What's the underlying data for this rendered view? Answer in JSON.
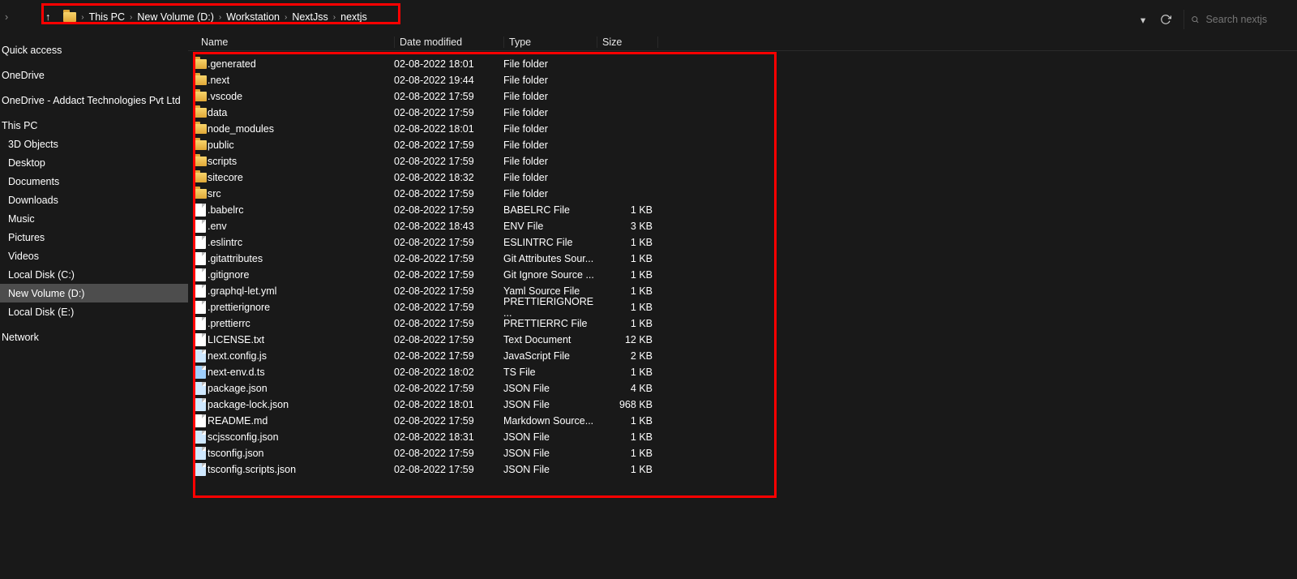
{
  "breadcrumb": {
    "items": [
      "This PC",
      "New Volume (D:)",
      "Workstation",
      "NextJss",
      "nextjs"
    ]
  },
  "search": {
    "placeholder": "Search nextjs"
  },
  "sidebar": {
    "quick_access": "Quick access",
    "onedrive": "OneDrive",
    "onedrive_org": "OneDrive - Addact Technologies Pvt Ltd",
    "this_pc": "This PC",
    "items": [
      "3D Objects",
      "Desktop",
      "Documents",
      "Downloads",
      "Music",
      "Pictures",
      "Videos",
      "Local Disk (C:)",
      "New Volume (D:)",
      "Local Disk (E:)"
    ],
    "network": "Network"
  },
  "columns": {
    "name": "Name",
    "date": "Date modified",
    "type": "Type",
    "size": "Size"
  },
  "files": [
    {
      "icon": "folder",
      "name": ".generated",
      "date": "02-08-2022 18:01",
      "type": "File folder",
      "size": ""
    },
    {
      "icon": "folder",
      "name": ".next",
      "date": "02-08-2022 19:44",
      "type": "File folder",
      "size": ""
    },
    {
      "icon": "folder",
      "name": ".vscode",
      "date": "02-08-2022 17:59",
      "type": "File folder",
      "size": ""
    },
    {
      "icon": "folder",
      "name": "data",
      "date": "02-08-2022 17:59",
      "type": "File folder",
      "size": ""
    },
    {
      "icon": "folder",
      "name": "node_modules",
      "date": "02-08-2022 18:01",
      "type": "File folder",
      "size": ""
    },
    {
      "icon": "folder",
      "name": "public",
      "date": "02-08-2022 17:59",
      "type": "File folder",
      "size": ""
    },
    {
      "icon": "folder",
      "name": "scripts",
      "date": "02-08-2022 17:59",
      "type": "File folder",
      "size": ""
    },
    {
      "icon": "folder",
      "name": "sitecore",
      "date": "02-08-2022 18:32",
      "type": "File folder",
      "size": ""
    },
    {
      "icon": "folder",
      "name": "src",
      "date": "02-08-2022 17:59",
      "type": "File folder",
      "size": ""
    },
    {
      "icon": "file",
      "name": ".babelrc",
      "date": "02-08-2022 17:59",
      "type": "BABELRC File",
      "size": "1 KB"
    },
    {
      "icon": "file",
      "name": ".env",
      "date": "02-08-2022 18:43",
      "type": "ENV File",
      "size": "3 KB"
    },
    {
      "icon": "file",
      "name": ".eslintrc",
      "date": "02-08-2022 17:59",
      "type": "ESLINTRC File",
      "size": "1 KB"
    },
    {
      "icon": "file",
      "name": ".gitattributes",
      "date": "02-08-2022 17:59",
      "type": "Git Attributes Sour...",
      "size": "1 KB"
    },
    {
      "icon": "file",
      "name": ".gitignore",
      "date": "02-08-2022 17:59",
      "type": "Git Ignore Source ...",
      "size": "1 KB"
    },
    {
      "icon": "file",
      "name": ".graphql-let.yml",
      "date": "02-08-2022 17:59",
      "type": "Yaml Source File",
      "size": "1 KB"
    },
    {
      "icon": "file",
      "name": ".prettierignore",
      "date": "02-08-2022 17:59",
      "type": "PRETTIERIGNORE ...",
      "size": "1 KB"
    },
    {
      "icon": "file",
      "name": ".prettierrc",
      "date": "02-08-2022 17:59",
      "type": "PRETTIERRC File",
      "size": "1 KB"
    },
    {
      "icon": "file",
      "name": "LICENSE.txt",
      "date": "02-08-2022 17:59",
      "type": "Text Document",
      "size": "12 KB"
    },
    {
      "icon": "json",
      "name": "next.config.js",
      "date": "02-08-2022 17:59",
      "type": "JavaScript File",
      "size": "2 KB"
    },
    {
      "icon": "ts",
      "name": "next-env.d.ts",
      "date": "02-08-2022 18:02",
      "type": "TS File",
      "size": "1 KB"
    },
    {
      "icon": "json",
      "name": "package.json",
      "date": "02-08-2022 17:59",
      "type": "JSON File",
      "size": "4 KB"
    },
    {
      "icon": "json",
      "name": "package-lock.json",
      "date": "02-08-2022 18:01",
      "type": "JSON File",
      "size": "968 KB"
    },
    {
      "icon": "md",
      "name": "README.md",
      "date": "02-08-2022 17:59",
      "type": "Markdown Source...",
      "size": "1 KB"
    },
    {
      "icon": "json",
      "name": "scjssconfig.json",
      "date": "02-08-2022 18:31",
      "type": "JSON File",
      "size": "1 KB"
    },
    {
      "icon": "json",
      "name": "tsconfig.json",
      "date": "02-08-2022 17:59",
      "type": "JSON File",
      "size": "1 KB"
    },
    {
      "icon": "json",
      "name": "tsconfig.scripts.json",
      "date": "02-08-2022 17:59",
      "type": "JSON File",
      "size": "1 KB"
    }
  ]
}
